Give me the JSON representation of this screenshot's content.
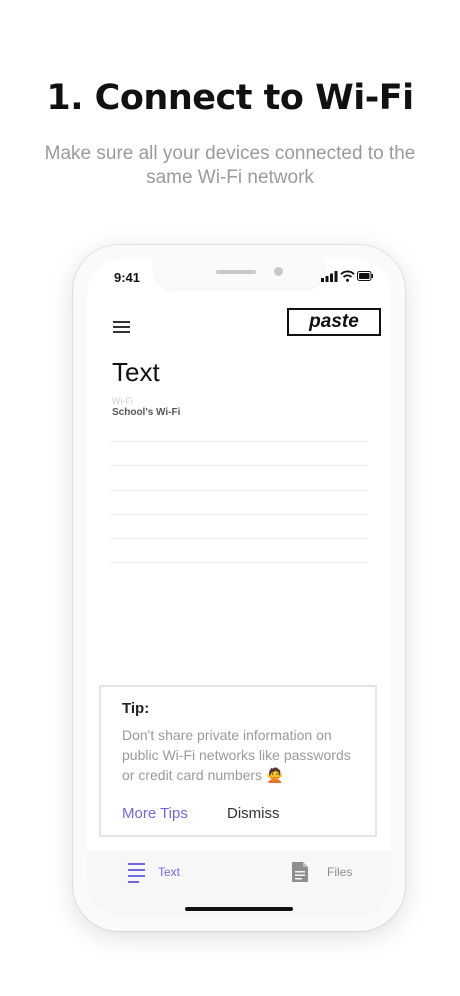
{
  "heading": "1. Connect to Wi-Fi",
  "subheading": "Make sure all your devices connected to the same Wi-Fi network",
  "status_bar": {
    "time": "9:41"
  },
  "app": {
    "logo_text": "paste",
    "note_title": "Text",
    "meta_label": "Wi-Fi",
    "meta_value": "School's Wi-Fi"
  },
  "tip": {
    "title": "Tip:",
    "body": "Don't share private information on public Wi-Fi networks like passwords or credit card numbers",
    "emoji": "🙅",
    "more_label": "More Tips",
    "dismiss_label": "Dismiss"
  },
  "tabs": [
    {
      "label": "Text",
      "icon": "text-lines-icon",
      "active": true
    },
    {
      "label": "Files",
      "icon": "document-icon",
      "active": false
    }
  ],
  "colors": {
    "accent": "#6f68e0",
    "text": "#111111",
    "muted": "#9a9a9a"
  }
}
